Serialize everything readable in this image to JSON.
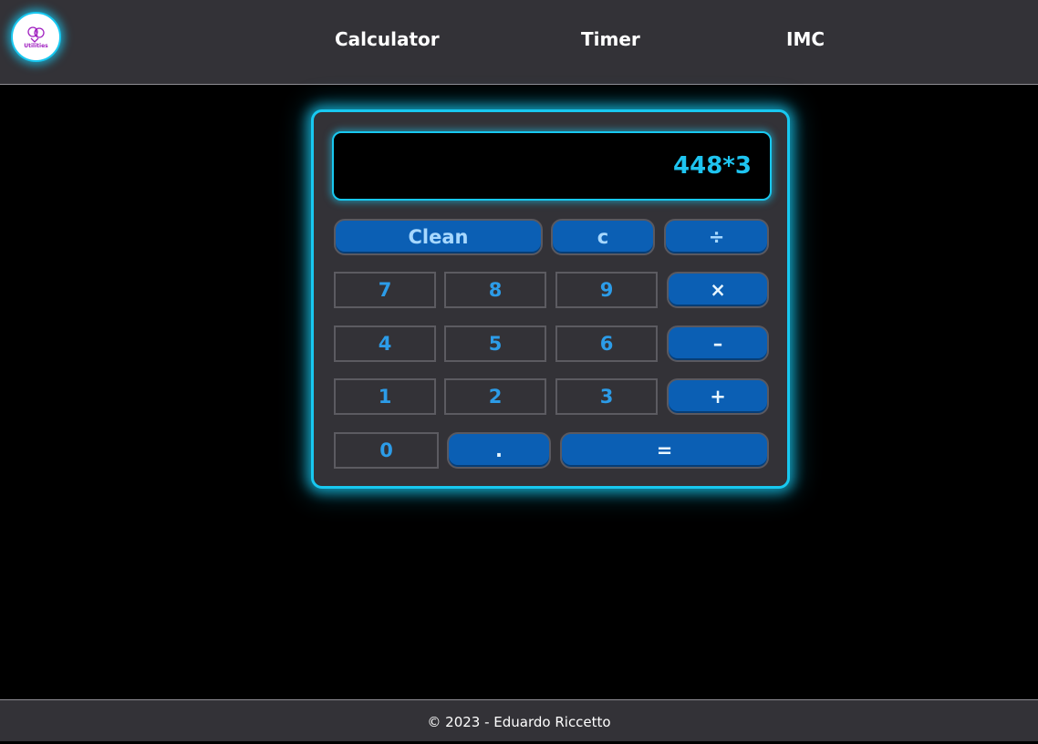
{
  "logo": {
    "text": "Utilities",
    "icon": "brain-icon"
  },
  "nav": {
    "items": [
      {
        "label": "Calculator"
      },
      {
        "label": "Timer"
      },
      {
        "label": "IMC"
      }
    ]
  },
  "calculator": {
    "display": "448*3",
    "keys": {
      "clean": "Clean",
      "c": "c",
      "divide": "÷",
      "seven": "7",
      "eight": "8",
      "nine": "9",
      "multiply": "×",
      "four": "4",
      "five": "5",
      "six": "6",
      "minus": "–",
      "one": "1",
      "two": "2",
      "three": "3",
      "plus": "+",
      "zero": "0",
      "dot": ".",
      "equals": "="
    }
  },
  "footer": {
    "text": "© 2023 - Eduardo Riccetto"
  },
  "colors": {
    "accent_glow": "#18c8f0",
    "display_text": "#1ec4f0",
    "number_key_text": "#2c9ce8",
    "operator_key_bg": "#0b5fb4",
    "panel_bg": "#333237"
  }
}
